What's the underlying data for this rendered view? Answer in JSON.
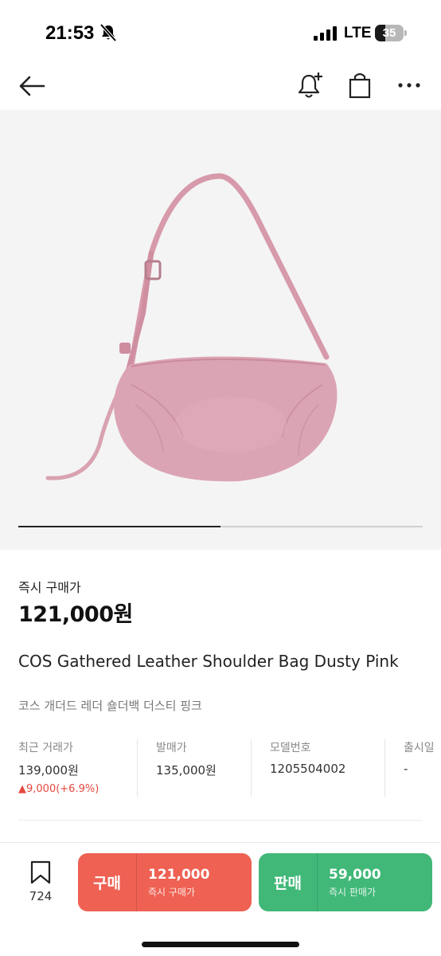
{
  "status_bar": {
    "time": "21:53",
    "network": "LTE",
    "battery_level": "35",
    "icons": [
      "mute-bell-icon",
      "signal-bars-icon",
      "battery-icon"
    ]
  },
  "nav": {
    "icons": [
      "back-arrow-icon",
      "bell-plus-icon",
      "shopping-bag-icon",
      "more-horizontal-icon"
    ]
  },
  "product_image": {
    "carousel_progress": 0.5,
    "bag_color": "#dba4b4"
  },
  "price": {
    "label": "즉시 구매가",
    "value": "121,000원"
  },
  "product": {
    "title": "COS Gathered Leather Shoulder Bag Dusty Pink",
    "subtitle": "코스 개더드 레더 숄더백 더스티 핑크"
  },
  "details": {
    "recent_label": "최근 거래가",
    "recent_value": "139,000원",
    "recent_change": "▲9,000(+6.9%)",
    "release_price_label": "발매가",
    "release_price_value": "135,000원",
    "model_label": "모델번호",
    "model_value": "1205504002",
    "release_date_label": "출시일",
    "release_date_value": "-"
  },
  "bottom": {
    "wish_count": "724",
    "buy": {
      "action": "구매",
      "price": "121,000",
      "sub": "즉시 구매가"
    },
    "sell": {
      "action": "판매",
      "price": "59,000",
      "sub": "즉시 판매가"
    }
  },
  "colors": {
    "buy": "#ee6153",
    "sell": "#41b878",
    "price_change": "#e5483f"
  }
}
